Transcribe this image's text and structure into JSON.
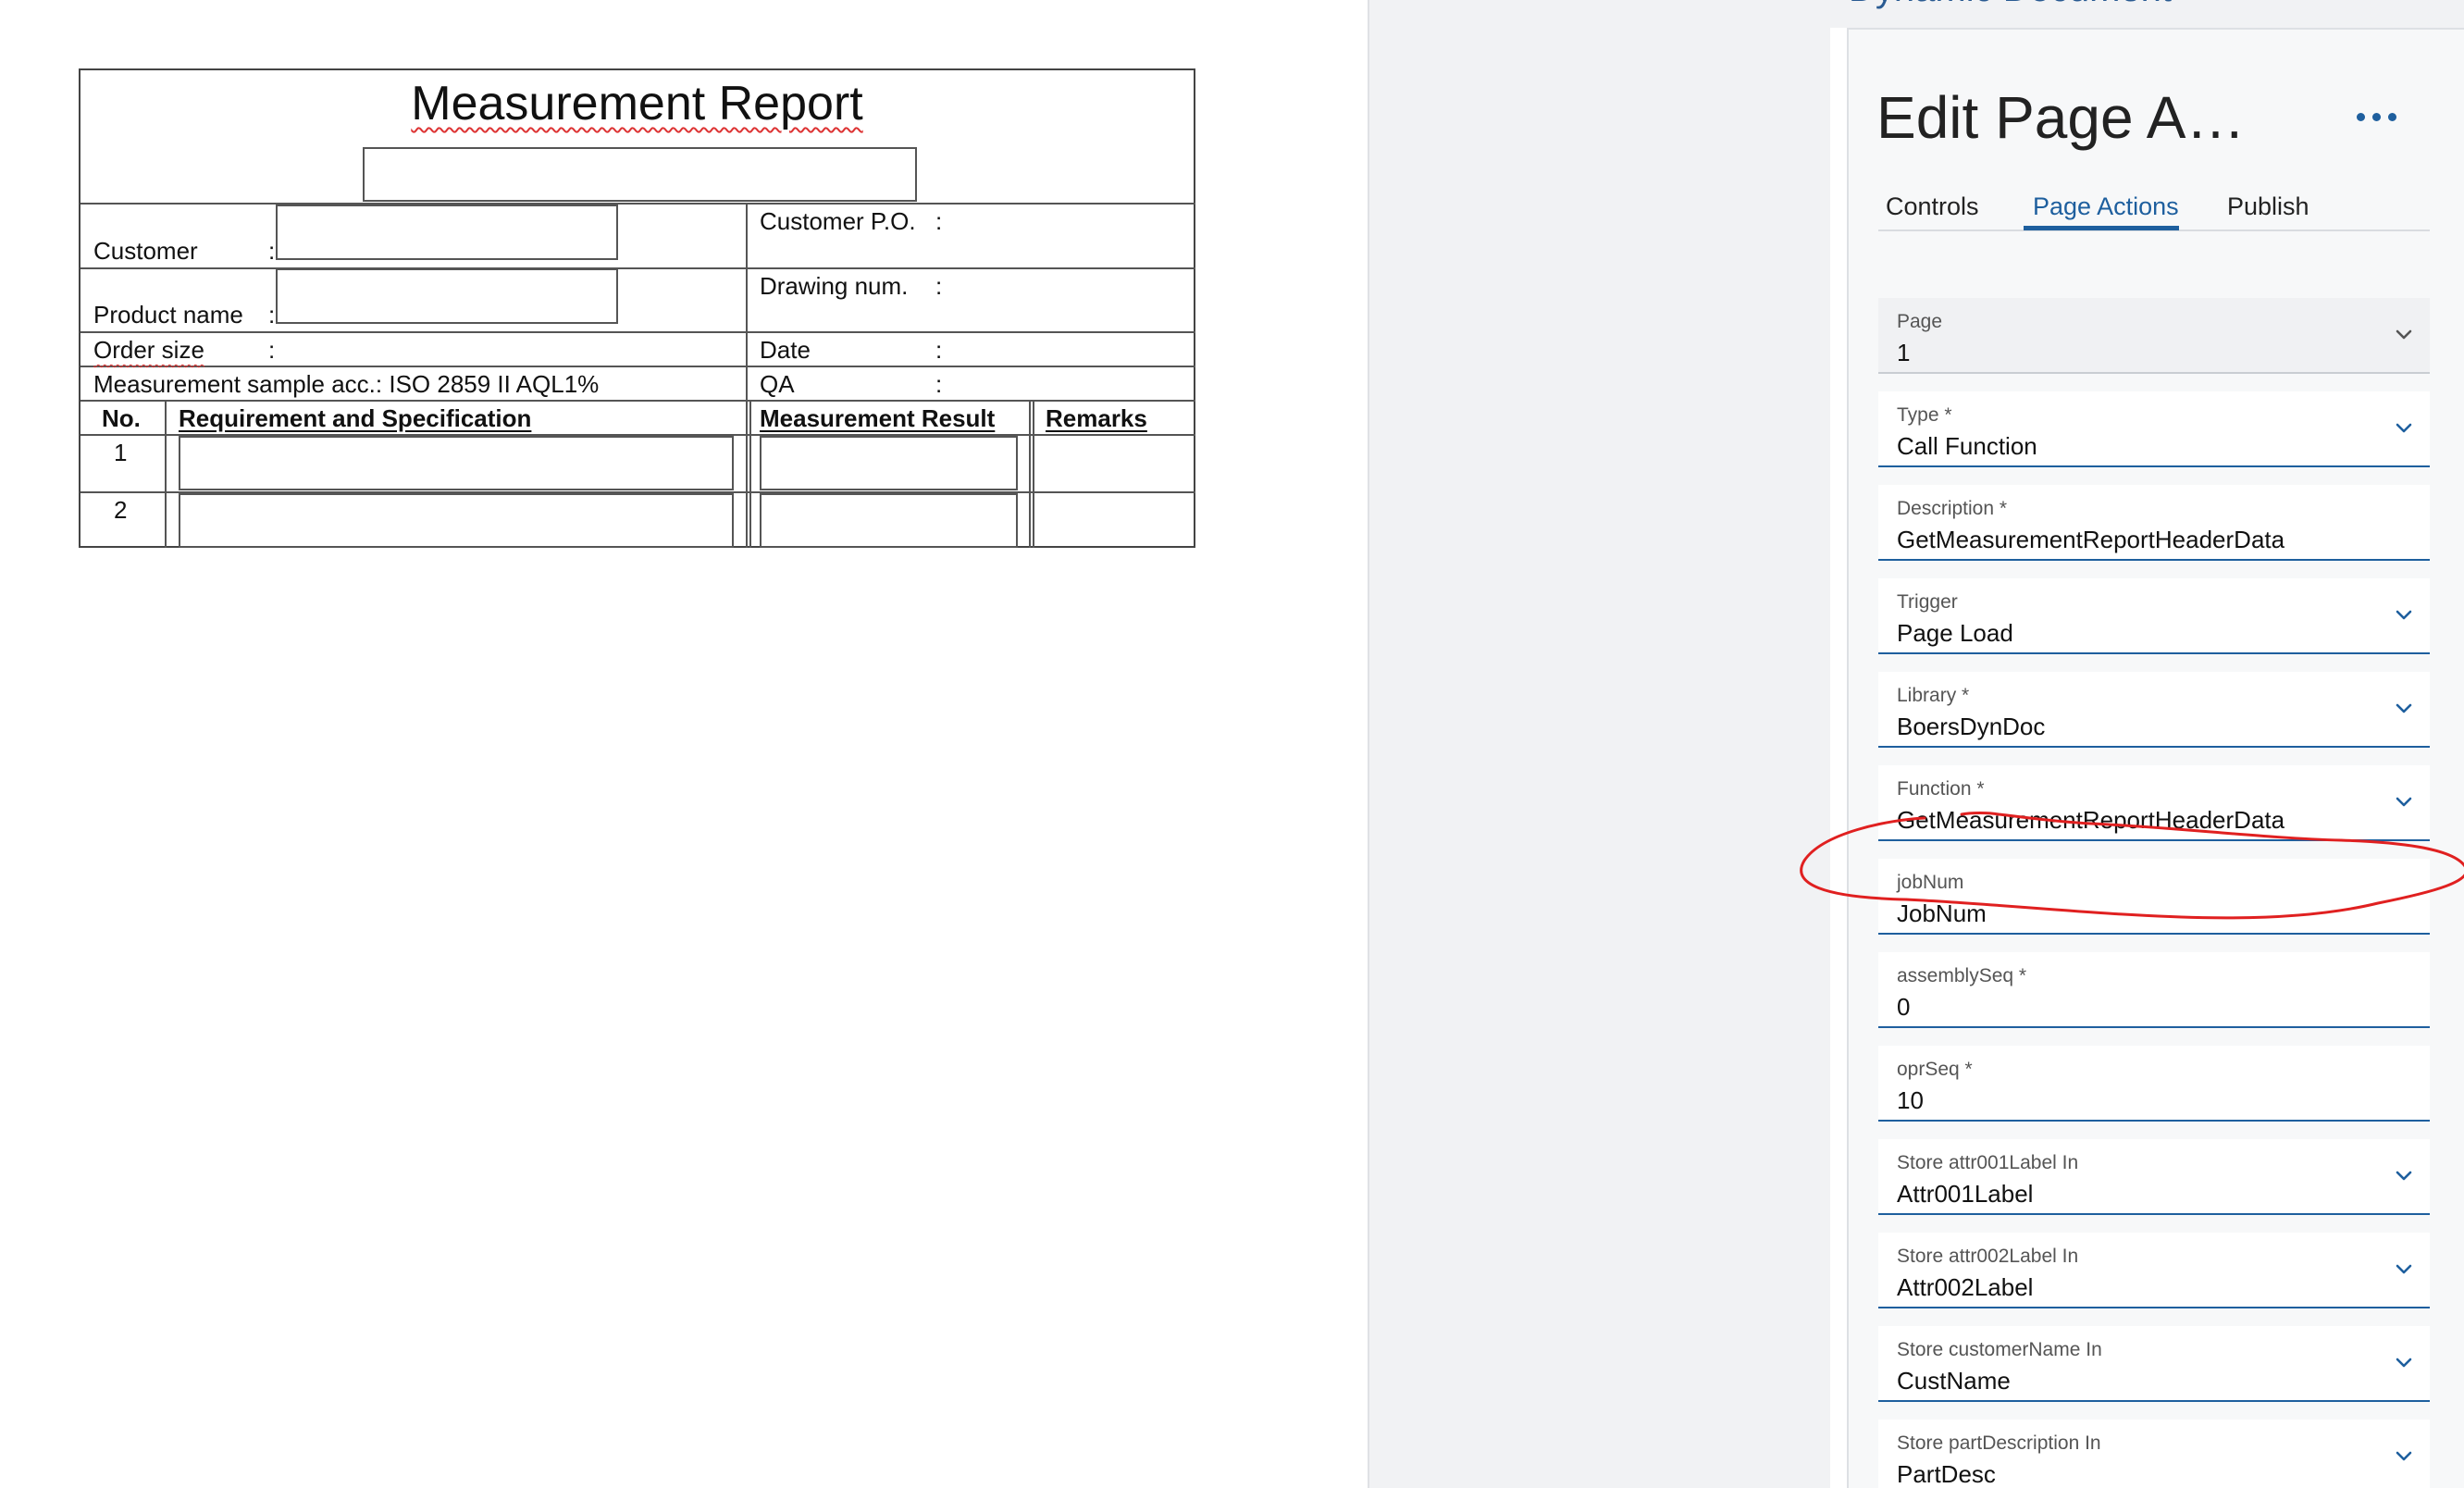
{
  "report": {
    "title": "Measurement Report",
    "customer_label": "Customer",
    "product_name_label": "Product name",
    "order_size_label": "Order size",
    "sample_label": "Measurement sample acc.: ISO 2859 II AQL1%",
    "customer_po_label": "Customer P.O.",
    "drawing_num_label": "Drawing num.",
    "date_label": "Date",
    "qa_label": "QA",
    "colon": ":",
    "headers": {
      "no": "No.",
      "requirement": "Requirement and Specification",
      "result": "Measurement Result",
      "remarks": "Remarks"
    },
    "rows": [
      "1",
      "2"
    ]
  },
  "background_title": "Dynamic Document",
  "panel": {
    "title": "Edit Page A…",
    "tabs": [
      {
        "label": "Controls",
        "active": false
      },
      {
        "label": "Page Actions",
        "active": true
      },
      {
        "label": "Publish",
        "active": false
      }
    ],
    "fields": [
      {
        "label": "Page",
        "value": "1",
        "dropdown": true,
        "readonly": true
      },
      {
        "label": "Type *",
        "value": "Call Function",
        "dropdown": true
      },
      {
        "label": "Description *",
        "value": "GetMeasurementReportHeaderData",
        "dropdown": false
      },
      {
        "label": "Trigger",
        "value": "Page Load",
        "dropdown": true
      },
      {
        "label": "Library *",
        "value": "BoersDynDoc",
        "dropdown": true
      },
      {
        "label": "Function *",
        "value": "GetMeasurementReportHeaderData",
        "dropdown": true
      },
      {
        "label": "jobNum",
        "value": "JobNum",
        "dropdown": false
      },
      {
        "label": "assemblySeq *",
        "value": "0",
        "dropdown": false
      },
      {
        "label": "oprSeq *",
        "value": "10",
        "dropdown": false
      },
      {
        "label": "Store attr001Label In",
        "value": "Attr001Label",
        "dropdown": true
      },
      {
        "label": "Store attr002Label In",
        "value": "Attr002Label",
        "dropdown": true
      },
      {
        "label": "Store customerName In",
        "value": "CustName",
        "dropdown": true
      },
      {
        "label": "Store partDescription In",
        "value": "PartDesc",
        "dropdown": true
      }
    ]
  },
  "colors": {
    "accent": "#1e5f9e",
    "annotation": "#e02020"
  }
}
